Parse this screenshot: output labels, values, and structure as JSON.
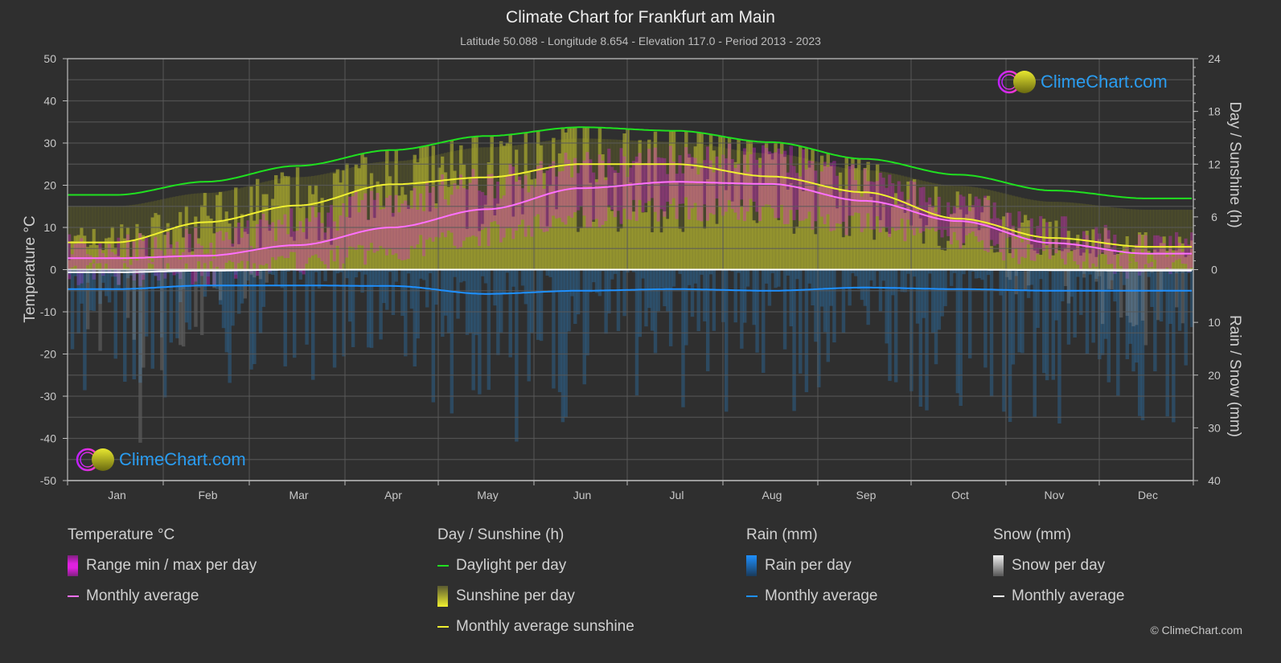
{
  "header": {
    "title": "Climate Chart for Frankfurt am Main",
    "subtitle": "Latitude 50.088 - Longitude 8.654 - Elevation 117.0 - Period 2013 - 2023"
  },
  "logo": {
    "text": "ClimeChart.com"
  },
  "copyright": "© ClimeChart.com",
  "legend": {
    "temperature": {
      "title": "Temperature °C",
      "items": [
        "Range min / max per day",
        "Monthly average"
      ]
    },
    "sunshine": {
      "title": "Day / Sunshine (h)",
      "items": [
        "Daylight per day",
        "Sunshine per day",
        "Monthly average sunshine"
      ]
    },
    "rain": {
      "title": "Rain (mm)",
      "items": [
        "Rain per day",
        "Monthly average"
      ]
    },
    "snow": {
      "title": "Snow (mm)",
      "items": [
        "Snow per day",
        "Monthly average"
      ]
    }
  },
  "colors": {
    "background": "#2f2f2f",
    "grid": "#5a5a5a",
    "temp_range": "#e020e0",
    "temp_avg": "#ff70ff",
    "daylight": "#20e020",
    "sunshine_bar": "#c8c832",
    "sunshine_avg": "#f0f030",
    "rain_bar": "#2a7fc0",
    "rain_avg": "#1e90ff",
    "snow_bar": "#9a9a9a",
    "snow_avg": "#ffffff",
    "logo_text": "#2a9cf0"
  },
  "chart_data": {
    "type": "area",
    "title": "Climate Chart for Frankfurt am Main",
    "categories": [
      "Jan",
      "Feb",
      "Mar",
      "Apr",
      "May",
      "Jun",
      "Jul",
      "Aug",
      "Sep",
      "Oct",
      "Nov",
      "Dec"
    ],
    "axes": {
      "left": {
        "label": "Temperature °C",
        "range": [
          -50,
          50
        ],
        "ticks": [
          50,
          40,
          30,
          20,
          10,
          0,
          -10,
          -20,
          -30,
          -40,
          -50
        ]
      },
      "right_top": {
        "label": "Day / Sunshine (h)",
        "range": [
          0,
          24
        ],
        "ticks": [
          24,
          18,
          12,
          6,
          0
        ]
      },
      "right_bottom": {
        "label": "Rain / Snow (mm)",
        "range": [
          0,
          40
        ],
        "ticks": [
          0,
          10,
          20,
          30,
          40
        ]
      }
    },
    "grid": true,
    "series": [
      {
        "name": "Temperature monthly average (°C)",
        "axis": "left",
        "values": [
          2.7,
          3.3,
          5.8,
          10.0,
          14.3,
          19.3,
          20.8,
          20.3,
          16.3,
          11.5,
          6.3,
          3.8
        ]
      },
      {
        "name": "Temperature daily max mean (°C)",
        "axis": "left",
        "values": [
          5.0,
          6.5,
          11.0,
          16.5,
          20.5,
          24.5,
          26.5,
          26.0,
          21.0,
          15.0,
          9.0,
          5.5
        ]
      },
      {
        "name": "Temperature daily min mean (°C)",
        "axis": "left",
        "values": [
          -1.0,
          -1.0,
          1.5,
          4.5,
          8.5,
          12.5,
          14.5,
          14.0,
          10.5,
          7.0,
          3.0,
          0.5
        ]
      },
      {
        "name": "Daylight per day (h)",
        "axis": "right_top",
        "values": [
          8.5,
          10.0,
          11.8,
          13.6,
          15.2,
          16.2,
          15.8,
          14.5,
          12.6,
          10.8,
          9.0,
          8.1
        ]
      },
      {
        "name": "Monthly average sunshine (h)",
        "axis": "right_top",
        "values": [
          3.1,
          5.4,
          7.3,
          9.7,
          10.5,
          12.0,
          12.0,
          10.6,
          8.8,
          5.8,
          3.6,
          2.6
        ]
      },
      {
        "name": "Rain monthly average (mm/day)",
        "axis": "right_bottom",
        "values": [
          3.7,
          3.0,
          3.0,
          3.1,
          4.6,
          4.0,
          3.7,
          4.0,
          3.4,
          3.7,
          4.0,
          4.0
        ]
      },
      {
        "name": "Snow monthly average (mm/day)",
        "axis": "right_bottom",
        "values": [
          0.5,
          0.2,
          0.0,
          0.0,
          0.0,
          0.0,
          0.0,
          0.0,
          0.0,
          0.0,
          0.1,
          0.2
        ]
      }
    ],
    "legend_position": "bottom"
  }
}
